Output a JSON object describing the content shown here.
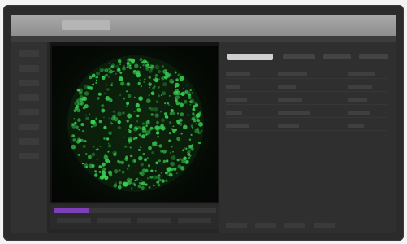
{
  "window": {
    "title": ""
  },
  "viewer": {
    "progress_fraction": 0.22,
    "accent": "#7d3fb8",
    "cell_color": "#39d353"
  },
  "right": {
    "selected_tab": ""
  }
}
